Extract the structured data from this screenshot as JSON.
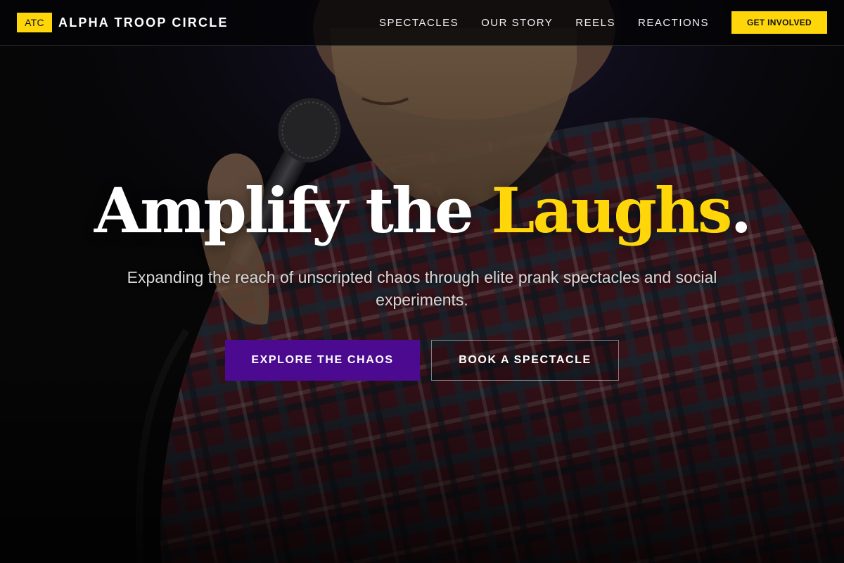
{
  "brand": {
    "badge": "ATC",
    "name": "ALPHA TROOP CIRCLE"
  },
  "nav": {
    "items": [
      {
        "label": "SPECTACLES"
      },
      {
        "label": "OUR STORY"
      },
      {
        "label": "REELS"
      },
      {
        "label": "REACTIONS"
      }
    ],
    "cta_label": "GET INVOLVED"
  },
  "hero": {
    "headline_main": "Amplify the ",
    "headline_accent": "Laughs",
    "headline_end": ".",
    "subtext": "Expanding the reach of unscripted chaos through elite prank spectacles and social experiments.",
    "primary_button": "EXPLORE THE CHAOS",
    "secondary_button": "BOOK A SPECTACLE",
    "background_image": "comedian-with-microphone-photo"
  },
  "colors": {
    "accent_yellow": "#ffd60a",
    "primary_purple": "#4b0a8f",
    "background": "#0b0b0d"
  }
}
